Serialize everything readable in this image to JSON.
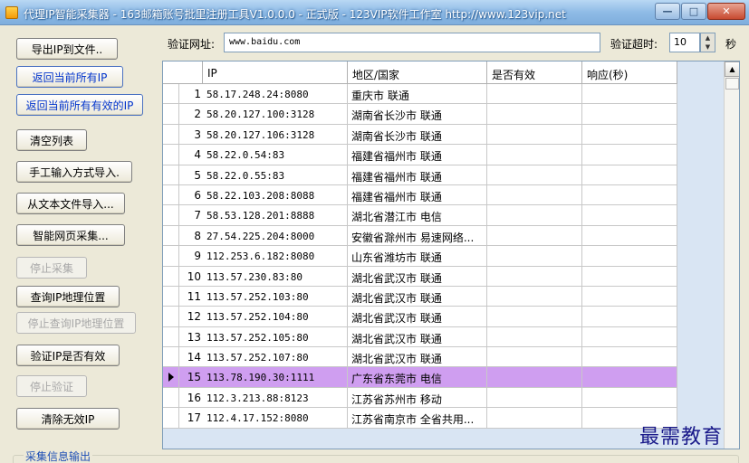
{
  "window": {
    "title": "代理IP智能采集器 - 163邮箱账号批里注册工具V1.0.0.0 - 正式版 - 123VIP软件工作室 http://www.123vip.net",
    "minimize": "—",
    "maximize": "□",
    "close": "✕"
  },
  "sidebar": {
    "buttons": [
      {
        "label": "导出IP到文件..",
        "state": "normal"
      },
      {
        "label": "返回当前所有IP",
        "state": "blue"
      },
      {
        "label": "返回当前所有有效的IP",
        "state": "blue"
      },
      {
        "label": "清空列表",
        "state": "normal"
      },
      {
        "label": "手工输入方式导入.",
        "state": "normal"
      },
      {
        "label": "从文本文件导入...",
        "state": "normal"
      },
      {
        "label": "智能网页采集...",
        "state": "normal"
      },
      {
        "label": "停止采集",
        "state": "disabled"
      },
      {
        "label": "查询IP地理位置",
        "state": "normal"
      },
      {
        "label": "停止查询IP地理位置",
        "state": "disabled"
      },
      {
        "label": "验证IP是否有效",
        "state": "normal"
      },
      {
        "label": "停止验证",
        "state": "disabled"
      },
      {
        "label": "清除无效IP",
        "state": "normal"
      }
    ]
  },
  "toolbar": {
    "url_label": "验证网址:",
    "url_value": "www.baidu.com",
    "timeout_label": "验证超时:",
    "timeout_value": "10",
    "unit_label": "秒"
  },
  "table": {
    "headers": {
      "ip": "IP",
      "region": "地区/国家",
      "valid": "是否有效",
      "response": "响应(秒)"
    },
    "selected_index": 14,
    "rows": [
      {
        "num": "1",
        "ip": "58.17.248.24:8080",
        "region": "重庆市  联通"
      },
      {
        "num": "2",
        "ip": "58.20.127.100:3128",
        "region": "湖南省长沙市  联通"
      },
      {
        "num": "3",
        "ip": "58.20.127.106:3128",
        "region": "湖南省长沙市  联通"
      },
      {
        "num": "4",
        "ip": "58.22.0.54:83",
        "region": "福建省福州市  联通"
      },
      {
        "num": "5",
        "ip": "58.22.0.55:83",
        "region": "福建省福州市  联通"
      },
      {
        "num": "6",
        "ip": "58.22.103.208:8088",
        "region": "福建省福州市 联通"
      },
      {
        "num": "7",
        "ip": "58.53.128.201:8888",
        "region": "湖北省潜江市  电信"
      },
      {
        "num": "8",
        "ip": "27.54.225.204:8000",
        "region": "安徽省滁州市 易速网络..."
      },
      {
        "num": "9",
        "ip": "112.253.6.182:8080",
        "region": "山东省潍坊市  联通"
      },
      {
        "num": "10",
        "ip": "113.57.230.83:80",
        "region": "湖北省武汉市 联通"
      },
      {
        "num": "11",
        "ip": "113.57.252.103:80",
        "region": "湖北省武汉市 联通"
      },
      {
        "num": "12",
        "ip": "113.57.252.104:80",
        "region": "湖北省武汉市 联通"
      },
      {
        "num": "13",
        "ip": "113.57.252.105:80",
        "region": "湖北省武汉市 联通"
      },
      {
        "num": "14",
        "ip": "113.57.252.107:80",
        "region": "湖北省武汉市 联通"
      },
      {
        "num": "15",
        "ip": "113.78.190.30:1111",
        "region": "广东省东莞市  电信"
      },
      {
        "num": "16",
        "ip": "112.3.213.88:8123",
        "region": "江苏省苏州市  移动"
      },
      {
        "num": "17",
        "ip": "112.4.17.152:8080",
        "region": "江苏省南京市 全省共用..."
      }
    ]
  },
  "footer": {
    "group_label": "采集信息输出"
  },
  "watermark": "最需教育",
  "colors": {
    "selected_row": "#cf9ef0",
    "link_blue": "#0033cc",
    "titlebar": "#8fbbe6"
  }
}
